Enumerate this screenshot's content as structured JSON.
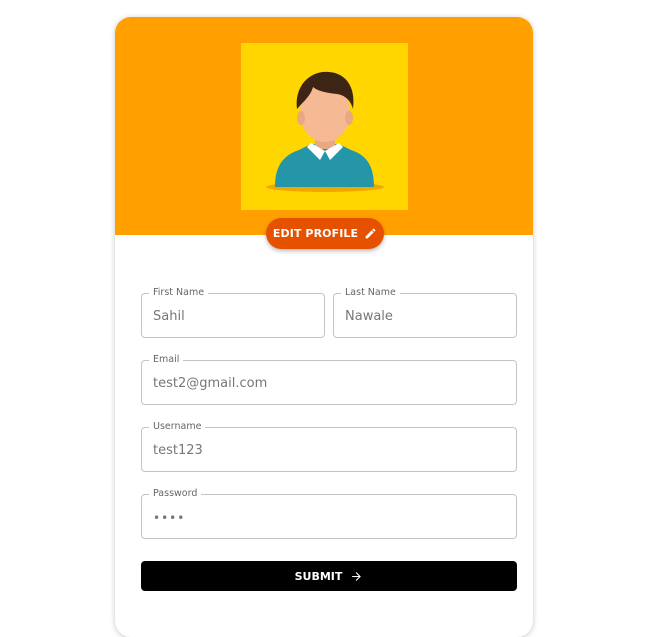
{
  "colors": {
    "header": "#ffa000",
    "avatar_bg": "#ffd600",
    "edit_button": "#e65100",
    "submit_button": "#000000"
  },
  "profile": {
    "avatar_icon": "person-avatar-icon",
    "edit_label": "EDIT PROFILE",
    "edit_icon": "pencil-icon"
  },
  "form": {
    "first_name": {
      "label": "First Name",
      "value": "Sahil"
    },
    "last_name": {
      "label": "Last Name",
      "value": "Nawale"
    },
    "email": {
      "label": "Email",
      "value": "test2@gmail.com"
    },
    "username": {
      "label": "Username",
      "value": "test123"
    },
    "password": {
      "label": "Password",
      "value": "••••"
    },
    "submit_label": "SUBMIT",
    "submit_icon": "arrow-right-icon"
  }
}
